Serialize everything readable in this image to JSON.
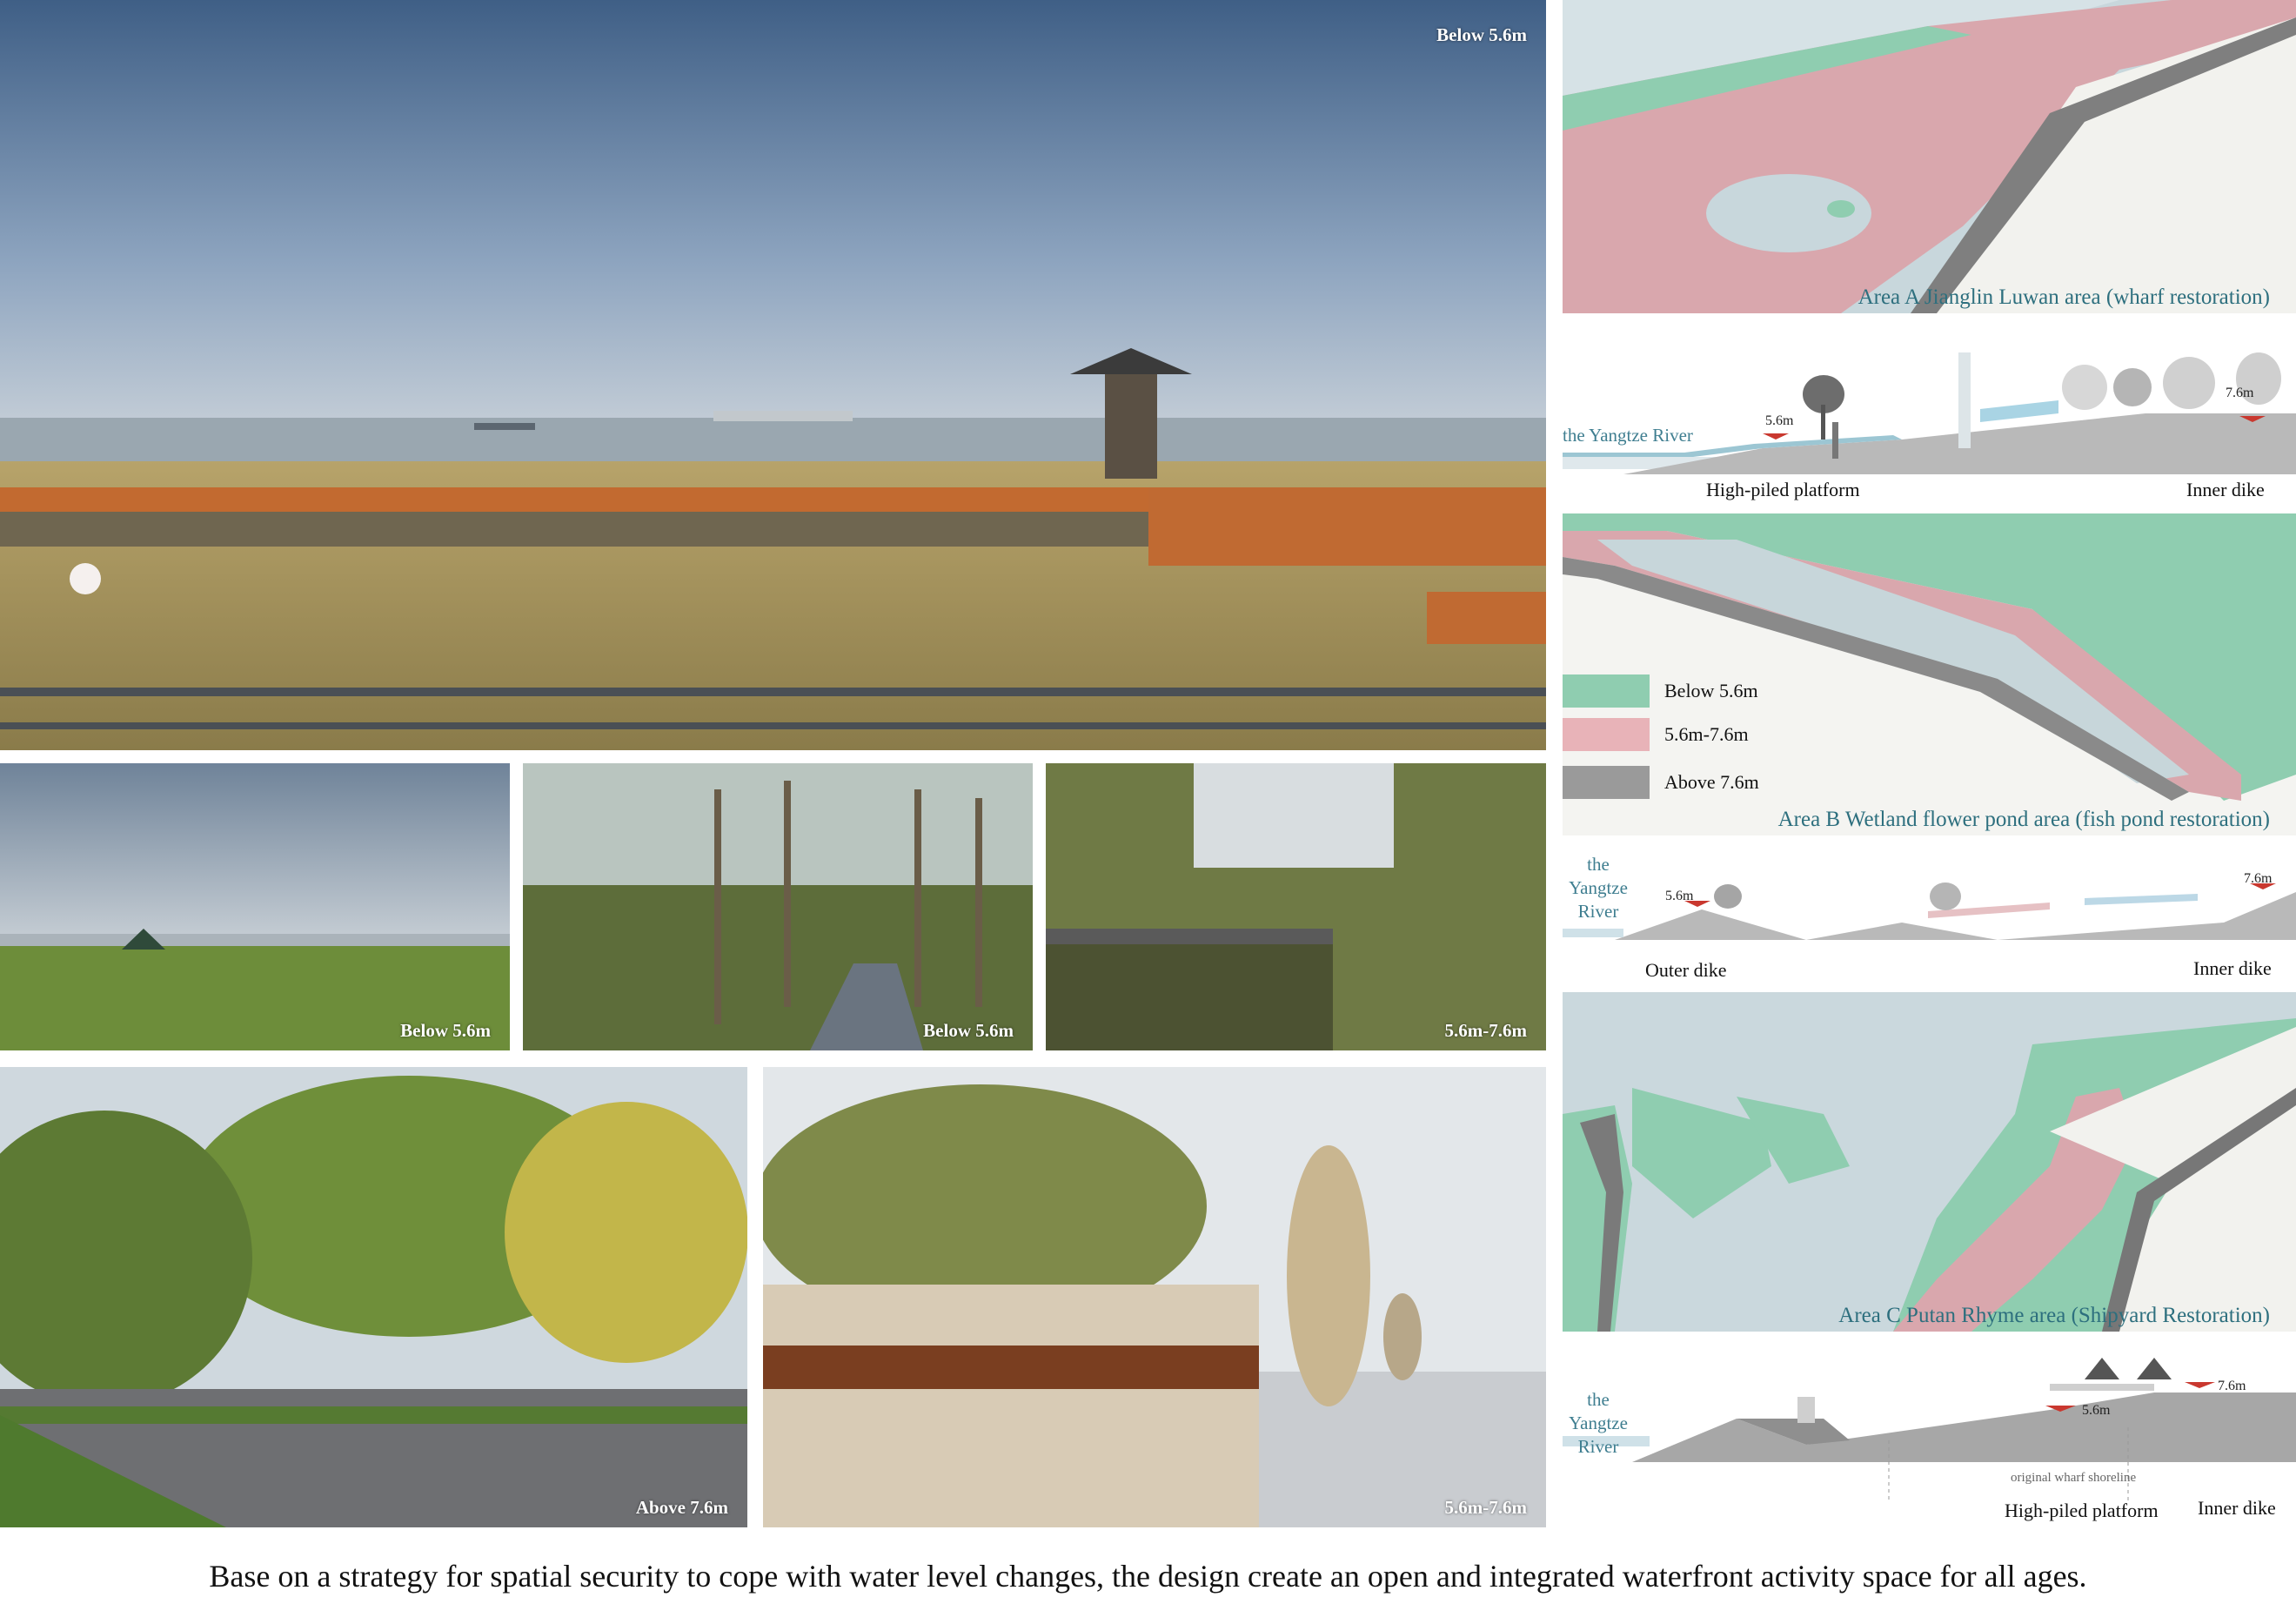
{
  "photos": {
    "main": {
      "tag": "Below 5.6m"
    },
    "p1": {
      "tag": "Below 5.6m"
    },
    "p2": {
      "tag": "Below 5.6m"
    },
    "p3": {
      "tag": "5.6m-7.6m"
    },
    "p4": {
      "tag": "Above 7.6m"
    },
    "p5": {
      "tag": "5.6m-7.6m"
    }
  },
  "area_a": {
    "caption": "Area A Jianglin Luwan area (wharf restoration)",
    "section": {
      "river": "the Yangtze River",
      "left_level": "5.6m",
      "right_level": "7.6m",
      "label_left": "High-piled platform",
      "label_right": "Inner dike"
    }
  },
  "area_b": {
    "caption": "Area B Wetland flower pond area (fish pond restoration)",
    "legend": [
      {
        "label": "Below 5.6m",
        "color": "#8fcdb0"
      },
      {
        "label": "5.6m-7.6m",
        "color": "#e8b3b8"
      },
      {
        "label": "Above 7.6m",
        "color": "#9a9a9a"
      }
    ],
    "section": {
      "river": "the Yangtze River",
      "left_level": "5.6m",
      "right_level": "7.6m",
      "label_left": "Outer dike",
      "label_right": "Inner dike"
    }
  },
  "area_c": {
    "caption": "Area C Putan Rhyme area (Shipyard Restoration)",
    "section": {
      "river": "the Yangtze River",
      "mid_level": "5.6m",
      "right_level": "7.6m",
      "shoreline": "original wharf shoreline",
      "label_left": "High-piled platform",
      "label_right": "Inner dike"
    }
  },
  "caption": "Base on a strategy for spatial security to cope with water level changes, the design create an open and integrated waterfront activity space for all ages."
}
